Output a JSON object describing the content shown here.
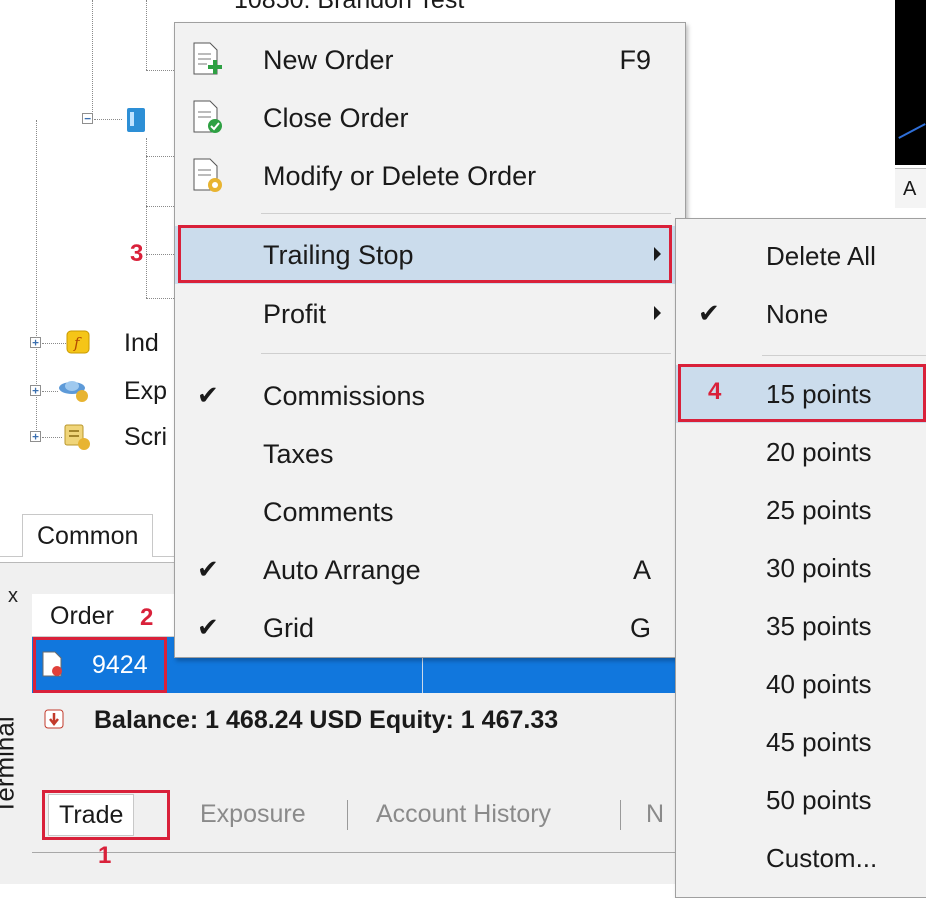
{
  "navigator": {
    "partial_top_label": "10850: Brandon Test",
    "items": [
      {
        "label": "Ind",
        "icon": "indicator-icon"
      },
      {
        "label": "Exp",
        "icon": "expert-advisor-icon"
      },
      {
        "label": "Scri",
        "icon": "script-icon"
      }
    ],
    "tab_common": "Common"
  },
  "chart": {
    "partial_label": "A"
  },
  "context_menu": {
    "items": [
      {
        "label": "New Order",
        "shortcut": "F9",
        "icon": "new-order-icon"
      },
      {
        "label": "Close Order",
        "icon": "close-order-icon"
      },
      {
        "label": "Modify or Delete Order",
        "icon": "modify-order-icon"
      },
      {
        "label": "Trailing Stop",
        "submenu": true
      },
      {
        "label": "Profit",
        "submenu": true
      },
      {
        "label": "Commissions",
        "checked": true
      },
      {
        "label": "Taxes"
      },
      {
        "label": "Comments"
      },
      {
        "label": "Auto Arrange",
        "shortcut": "A",
        "checked": true
      },
      {
        "label": "Grid",
        "shortcut": "G",
        "checked": true
      }
    ]
  },
  "submenu": {
    "items": [
      {
        "label": "Delete All"
      },
      {
        "label": "None",
        "checked": true
      },
      {
        "label": "15 points",
        "highlighted": true
      },
      {
        "label": "20 points"
      },
      {
        "label": "25 points"
      },
      {
        "label": "30 points"
      },
      {
        "label": "35 points"
      },
      {
        "label": "40 points"
      },
      {
        "label": "45 points"
      },
      {
        "label": "50 points"
      },
      {
        "label": "Custom..."
      }
    ]
  },
  "terminal": {
    "vertical_label": "Terminal",
    "close_glyph": "x",
    "column_order": "Order",
    "order_ticket": "9424",
    "balance_text": "Balance: 1 468.24 USD  Equity: 1 467.33",
    "tabs": [
      "Trade",
      "Exposure",
      "Account History",
      "N"
    ]
  },
  "annotations": {
    "step1": "1",
    "step2": "2",
    "step3": "3",
    "step4": "4",
    "color": "#d9213a"
  },
  "colors": {
    "selection_row": "#1177dd",
    "menu_highlight": "#cbdcec",
    "menu_bg": "#f2f2f2"
  }
}
